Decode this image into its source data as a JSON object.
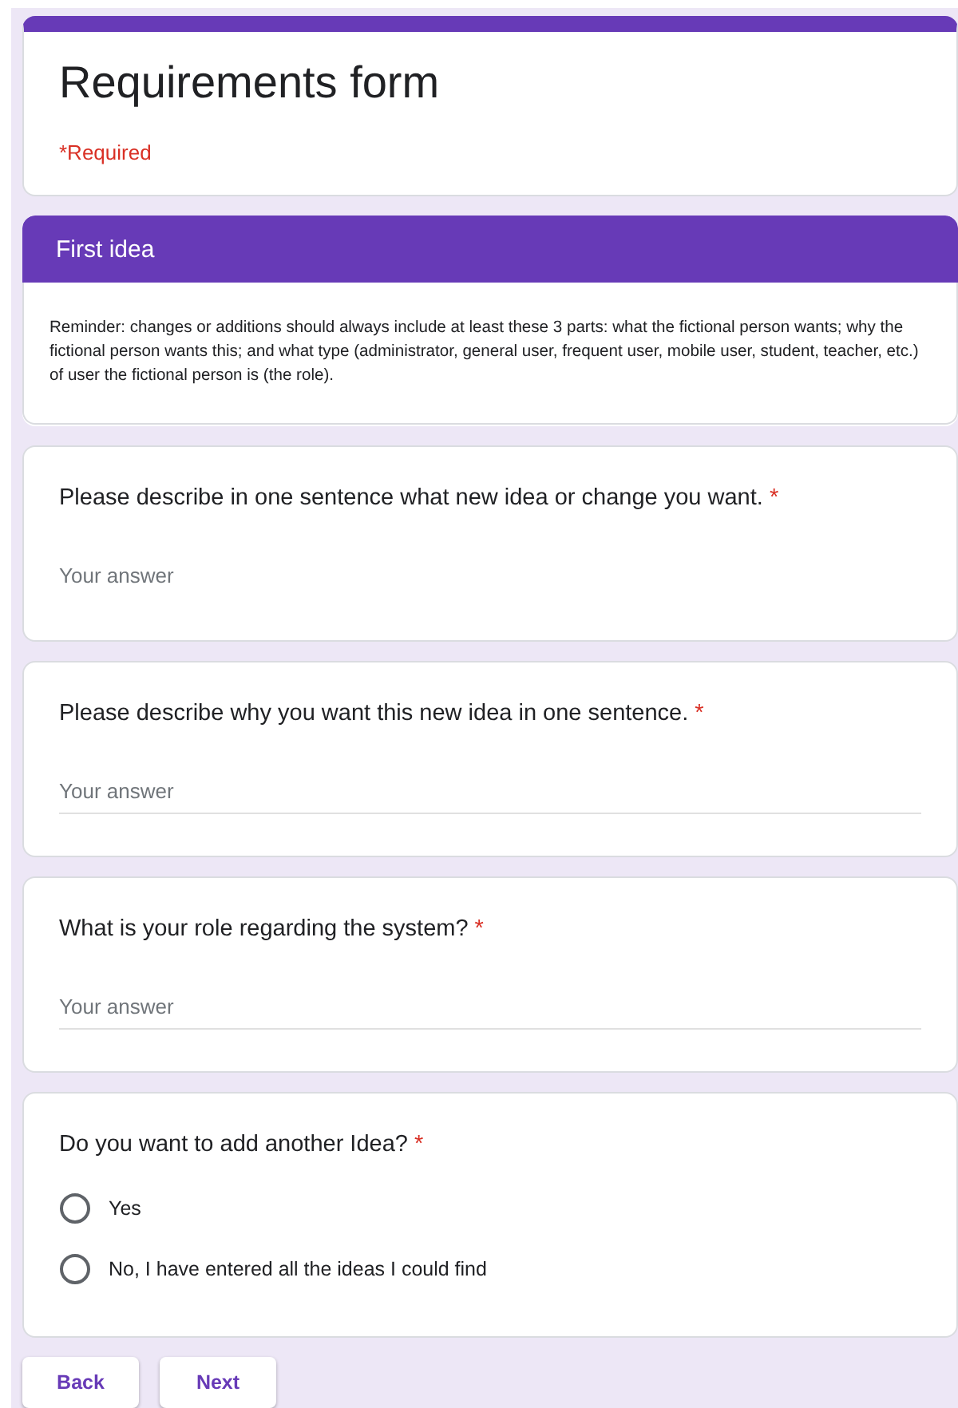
{
  "header": {
    "title": "Requirements form",
    "required_note": "*Required"
  },
  "section": {
    "title": "First idea",
    "description": "Reminder: changes or additions should always include at least these 3 parts: what the fictional person wants; why the fictional person wants this; and what type (administrator, general user, frequent user, mobile user, student, teacher, etc.) of user the fictional person is (the role)."
  },
  "questions": [
    {
      "kind": "text",
      "label": "Please describe in one sentence what new idea or change you want.",
      "required_mark": "*",
      "placeholder": "Your answer",
      "underlined": false
    },
    {
      "kind": "text",
      "label": "Please describe why you want this new idea in one sentence.",
      "required_mark": "*",
      "placeholder": "Your answer",
      "underlined": true
    },
    {
      "kind": "text",
      "label": "What is your role regarding the system?",
      "required_mark": "*",
      "placeholder": "Your answer",
      "underlined": true
    },
    {
      "kind": "radio",
      "label": "Do you want to add another Idea?",
      "required_mark": "*",
      "options": [
        {
          "label": "Yes",
          "selected": false
        },
        {
          "label": "No, I have entered all the ideas I could find",
          "selected": false
        }
      ]
    }
  ],
  "buttons": [
    "Back",
    "Next"
  ]
}
